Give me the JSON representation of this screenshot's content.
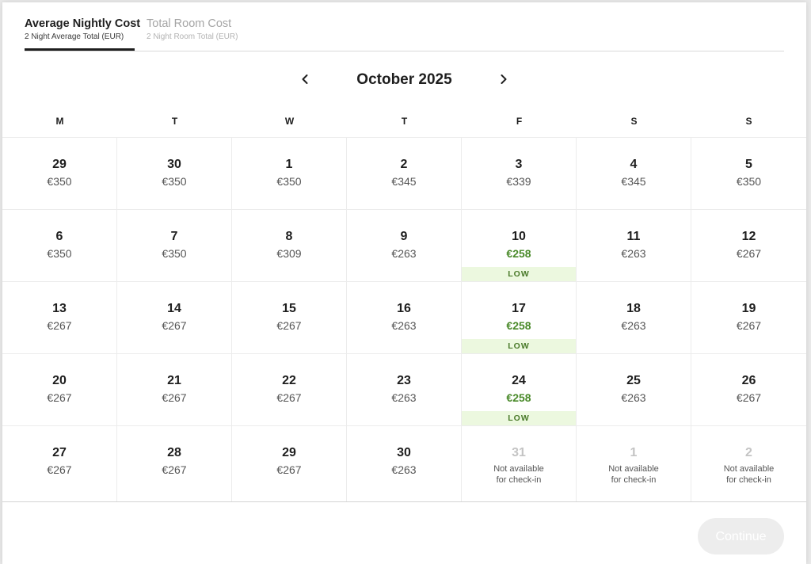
{
  "tabs": [
    {
      "title": "Average Nightly Cost",
      "subtitle": "2 Night Average Total (EUR)",
      "active": true
    },
    {
      "title": "Total Room Cost",
      "subtitle": "2 Night Room Total (EUR)",
      "active": false
    }
  ],
  "calendar": {
    "month_title": "October 2025",
    "weekdays": [
      "M",
      "T",
      "W",
      "T",
      "F",
      "S",
      "S"
    ],
    "low_label": "LOW",
    "unavailable_note": "Not available for check-in",
    "weeks": [
      [
        {
          "day": "29",
          "price": "€350"
        },
        {
          "day": "30",
          "price": "€350"
        },
        {
          "day": "1",
          "price": "€350"
        },
        {
          "day": "2",
          "price": "€345"
        },
        {
          "day": "3",
          "price": "€339"
        },
        {
          "day": "4",
          "price": "€345"
        },
        {
          "day": "5",
          "price": "€350"
        }
      ],
      [
        {
          "day": "6",
          "price": "€350"
        },
        {
          "day": "7",
          "price": "€350"
        },
        {
          "day": "8",
          "price": "€309"
        },
        {
          "day": "9",
          "price": "€263"
        },
        {
          "day": "10",
          "price": "€258",
          "low": true
        },
        {
          "day": "11",
          "price": "€263"
        },
        {
          "day": "12",
          "price": "€267"
        }
      ],
      [
        {
          "day": "13",
          "price": "€267"
        },
        {
          "day": "14",
          "price": "€267"
        },
        {
          "day": "15",
          "price": "€267"
        },
        {
          "day": "16",
          "price": "€263"
        },
        {
          "day": "17",
          "price": "€258",
          "low": true
        },
        {
          "day": "18",
          "price": "€263"
        },
        {
          "day": "19",
          "price": "€267"
        }
      ],
      [
        {
          "day": "20",
          "price": "€267"
        },
        {
          "day": "21",
          "price": "€267"
        },
        {
          "day": "22",
          "price": "€267"
        },
        {
          "day": "23",
          "price": "€263"
        },
        {
          "day": "24",
          "price": "€258",
          "low": true
        },
        {
          "day": "25",
          "price": "€263"
        },
        {
          "day": "26",
          "price": "€267"
        }
      ],
      [
        {
          "day": "27",
          "price": "€267"
        },
        {
          "day": "28",
          "price": "€267"
        },
        {
          "day": "29",
          "price": "€267"
        },
        {
          "day": "30",
          "price": "€263"
        },
        {
          "day": "31",
          "unavailable": true,
          "note_line1": "Not available",
          "note_line2": "for check-in"
        },
        {
          "day": "1",
          "unavailable": true,
          "note_line1": "Not available",
          "note_line2": "for check-in"
        },
        {
          "day": "2",
          "unavailable": true,
          "note_line1": "Not available",
          "note_line2": "for check-in"
        }
      ]
    ]
  },
  "footer": {
    "continue_label": "Continue"
  },
  "icons": {
    "prev": "chevron-left-icon",
    "next": "chevron-right-icon"
  },
  "colors": {
    "low_price": "#4a8a2a",
    "low_badge_bg": "#ecf8df",
    "active_tab_underline": "#1e1e1e",
    "continue_disabled_bg": "#ededed"
  }
}
